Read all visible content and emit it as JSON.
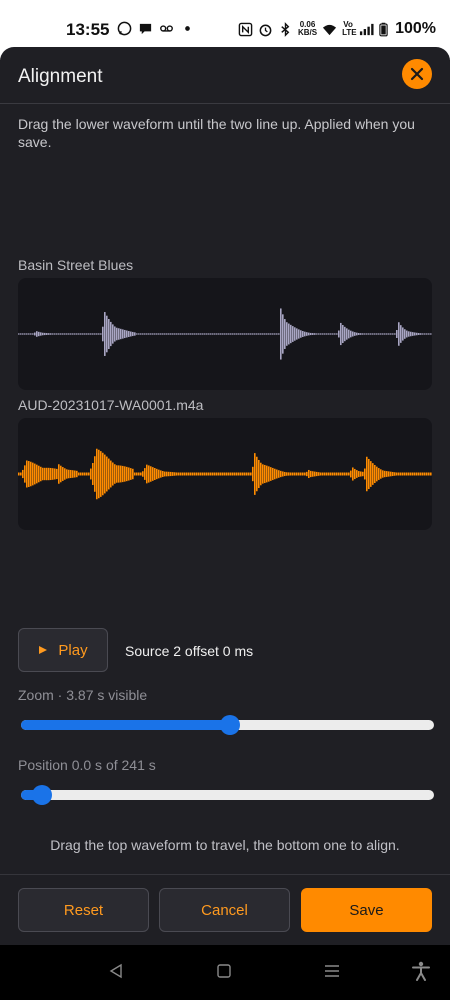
{
  "status_bar": {
    "time": "13:55",
    "net_speed": "0.06",
    "net_unit": "KB/S",
    "volte": "Vo LTE",
    "battery": "100%"
  },
  "dialog": {
    "title": "Alignment",
    "description": "Drag the lower waveform until the two line up. Applied when you save.",
    "track1_name": "Basin Street Blues",
    "track2_name": "AUD-20231017-WA0001.m4a",
    "play_label": "Play",
    "offset_text": "Source 2 offset 0 ms",
    "zoom_label": "Zoom · 3.87 s visible",
    "zoom_value": 0.505,
    "position_label": "Position 0.0 s of 241 s",
    "position_value": 0.05,
    "hint": "Drag the top waveform to travel, the bottom one to align.",
    "reset_label": "Reset",
    "cancel_label": "Cancel",
    "save_label": "Save"
  },
  "colors": {
    "accent": "#ff8a00",
    "wave1": "#a9a6c4",
    "wave2": "#ff8c00",
    "slider": "#1a73e8"
  },
  "nav": [
    "back-icon",
    "home-icon",
    "recents-icon",
    "accessibility-icon"
  ]
}
